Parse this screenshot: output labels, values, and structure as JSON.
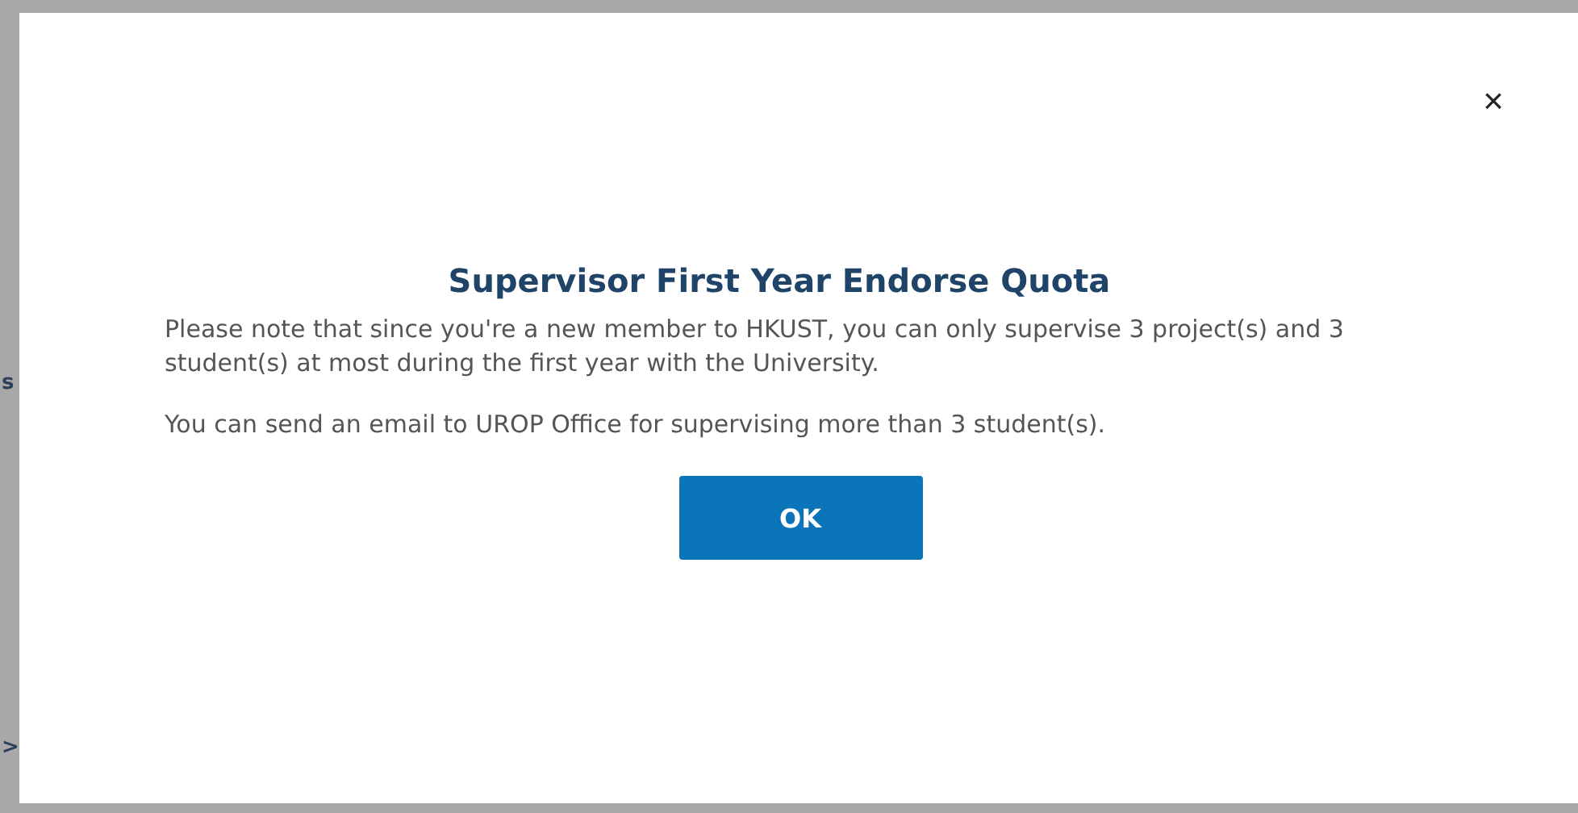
{
  "background": {
    "fragments": [
      {
        "text": "s"
      },
      {
        "text": ">"
      }
    ]
  },
  "dialog": {
    "close": "×",
    "title": "Supervisor First Year Endorse Quota",
    "paragraphs": [
      "Please note that since you're a new member to HKUST, you can only supervise 3 project(s) and 3 student(s) at most during the first year with the University.",
      "You can send an email to UROP Office for supervising more than 3 student(s)."
    ],
    "button": "OK"
  }
}
